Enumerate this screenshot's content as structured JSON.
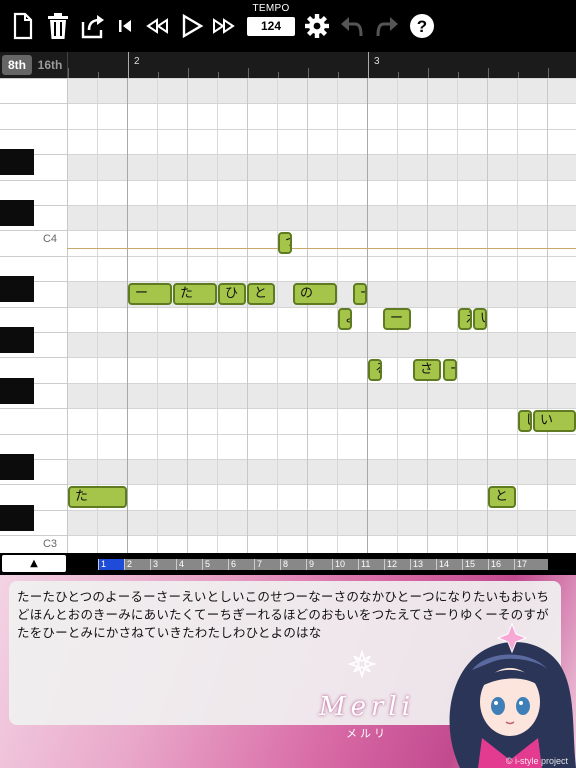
{
  "toolbar": {
    "tempo_label": "TEMPO",
    "tempo_value": "124",
    "icons": [
      "new-file-icon",
      "trash-icon",
      "share-icon",
      "skip-to-start-icon",
      "rewind-icon",
      "play-icon",
      "fast-forward-icon",
      "gear-icon",
      "undo-icon",
      "redo-icon",
      "help-icon"
    ]
  },
  "ruler": {
    "btn_8th": "8th",
    "btn_16th": "16th",
    "bar_2": "2",
    "bar_3": "3"
  },
  "keys": {
    "c4_label": "C4",
    "c3_label": "C3"
  },
  "notes": [
    "ー",
    "た",
    "ひ",
    "と",
    "の",
    "ー",
    "つ",
    "よ",
    "ー",
    "え",
    "い",
    "る",
    "さ",
    "ー",
    "し",
    "い",
    "た",
    "と"
  ],
  "scroll": {
    "up_arrow": "▲",
    "measures": [
      "1",
      "2",
      "3",
      "4",
      "5",
      "6",
      "7",
      "8",
      "9",
      "10",
      "11",
      "12",
      "13",
      "14",
      "15",
      "16",
      "17"
    ],
    "active_measure": "1"
  },
  "lyrics": {
    "text": "たーたひとつのよーるーさーえいとしいこのせつーなーさのなかひとーつになりたいもおいちどほんとおのきーみにあいたくてーちぎーれるほどのおもいをつたえてさーりゆくーそのすがたをひーとみにかさねていきたわたしわひとよのはな"
  },
  "branding": {
    "logo": "Merli",
    "logo_sub": "メルリ",
    "copyright": "© i-style project"
  },
  "colors": {
    "note_fill": "#a5c54a",
    "note_border": "#5f7b22",
    "active_measure": "#1e4bd8",
    "panel_pink": "#d86aa6"
  }
}
